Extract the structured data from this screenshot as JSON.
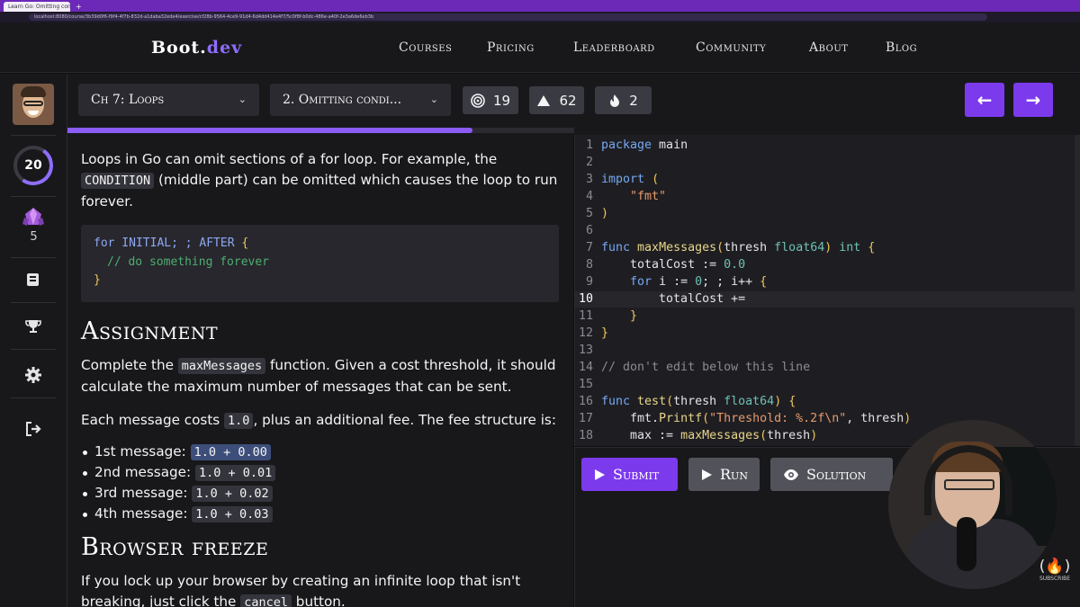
{
  "browser": {
    "tab_title": "Learn Go: Omitting conditi...",
    "new_tab": "+",
    "url": "localhost:8080/course/3b39d0f6-f9f4-4f7b-832d-a1daba32ede4/exercise/cf28b-9564-4ce9-91d4-6d4dd414e4f7/5c0f8f-b0dc-486e-a40f-2e3a6de6eb3b"
  },
  "nav": {
    "logo_main": "Boot.",
    "logo_accent": "dev",
    "links": [
      "Courses",
      "Pricing",
      "Leaderboard",
      "Community",
      "About",
      "Blog"
    ]
  },
  "sidebar": {
    "level": "20",
    "gems": "5",
    "icons": [
      "courses-icon",
      "trophy-icon",
      "settings-icon",
      "logout-icon"
    ]
  },
  "toolbar": {
    "chapter": "Ch 7: Loops",
    "lesson": "2. Omitting condi...",
    "stats": [
      "19",
      "62",
      "2"
    ],
    "progress_percent": 80
  },
  "lesson": {
    "intro_a": "Loops in Go can omit sections of a for loop. For example, the ",
    "intro_code": "CONDITION",
    "intro_b": " (middle part) can be omitted which causes the loop to run forever.",
    "code_for": "for",
    "code_initial": " INITIAL; ; AFTER ",
    "code_open": "{",
    "code_comment": "// do something forever",
    "code_close": "}",
    "assignment_title": "Assignment",
    "assign_a": "Complete the ",
    "assign_code": "maxMessages",
    "assign_b": " function. Given a cost threshold, it should calculate the maximum number of messages that can be sent.",
    "fee_a": "Each message costs ",
    "fee_code": "1.0",
    "fee_b": ", plus an additional fee. The fee structure is:",
    "fees": [
      {
        "label": "1st message: ",
        "value": "1.0 + 0.00"
      },
      {
        "label": "2nd message: ",
        "value": "1.0 + 0.01"
      },
      {
        "label": "3rd message: ",
        "value": "1.0 + 0.02"
      },
      {
        "label": "4th message: ",
        "value": "1.0 + 0.03"
      }
    ],
    "freeze_title": "Browser freeze",
    "freeze_a": "If you lock up your browser by creating an infinite loop that isn't breaking, just click the ",
    "freeze_code": "cancel",
    "freeze_b": " button."
  },
  "editor": {
    "line_numbers": [
      "1",
      "2",
      "3",
      "4",
      "5",
      "6",
      "7",
      "8",
      "9",
      "10",
      "11",
      "12",
      "13",
      "14",
      "15",
      "16",
      "17",
      "18"
    ],
    "active_line": "10",
    "lines": [
      "package main",
      "",
      "import (",
      "    \"fmt\"",
      ")",
      "",
      "func maxMessages(thresh float64) int {",
      "    totalCost := 0.0",
      "    for i := 0; ; i++ {",
      "        totalCost +=",
      "    }",
      "}",
      "",
      "// don't edit below this line",
      "",
      "func test(thresh float64) {",
      "    fmt.Printf(\"Threshold: %.2f\\n\", thresh)",
      "    max := maxMessages(thresh)"
    ]
  },
  "actions": {
    "submit": "Submit",
    "run": "Run",
    "solution": "Solution"
  },
  "overlay": {
    "subscribe": "SUBSCRIBE"
  },
  "colors": {
    "accent": "#7c3aed",
    "progress": "#8b5cf6",
    "background": "#18181b"
  }
}
